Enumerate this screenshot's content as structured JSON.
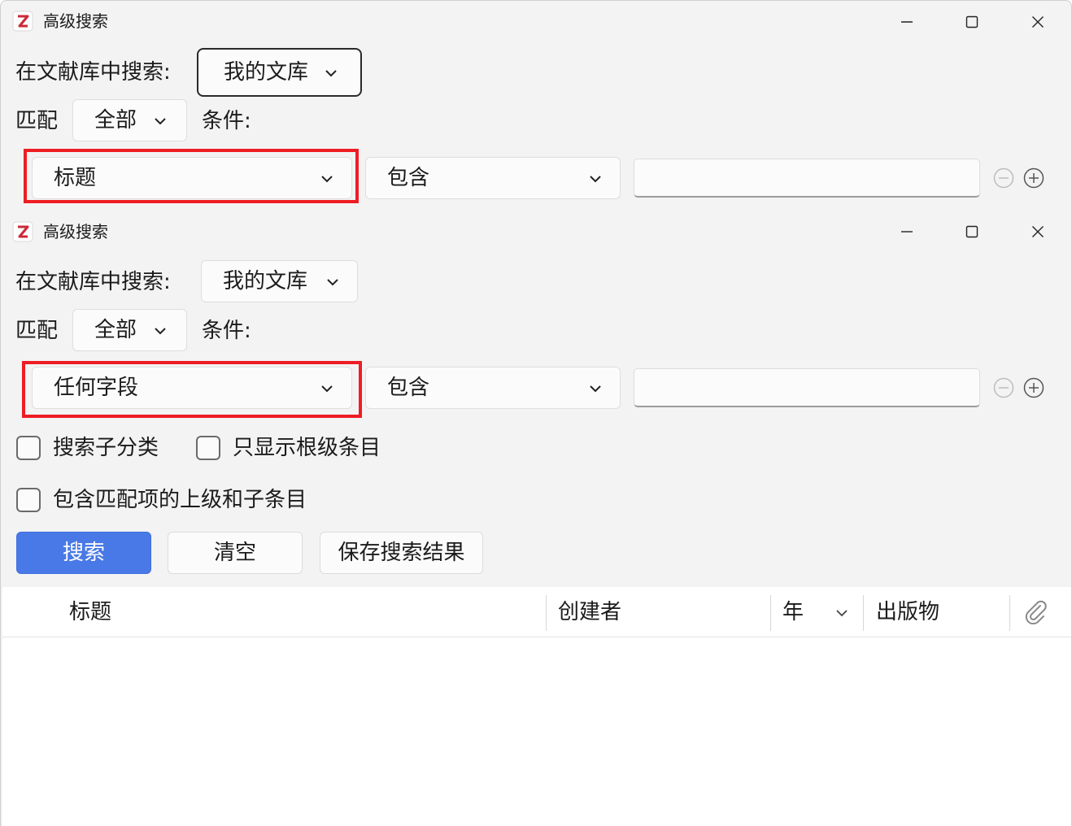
{
  "window_top": {
    "title": "高级搜索",
    "library_label": "在文献库中搜索:",
    "library_value": "我的文库",
    "match_label": "匹配",
    "match_value": "全部",
    "conditions_label": "条件:",
    "field_value": "标题",
    "operator_value": "包含",
    "search_text": ""
  },
  "window_bottom": {
    "title": "高级搜索",
    "library_label": "在文献库中搜索:",
    "library_value": "我的文库",
    "match_label": "匹配",
    "match_value": "全部",
    "conditions_label": "条件:",
    "field_value": "任何字段",
    "operator_value": "包含",
    "search_text": "",
    "checkboxes": [
      {
        "label": "搜索子分类",
        "checked": false
      },
      {
        "label": "只显示根级条目",
        "checked": false
      },
      {
        "label": "包含匹配项的上级和子条目",
        "checked": false
      }
    ],
    "buttons": {
      "search": "搜索",
      "clear": "清空",
      "save": "保存搜索结果"
    },
    "columns": {
      "title": "标题",
      "creator": "创建者",
      "year": "年",
      "publication": "出版物"
    }
  },
  "colors": {
    "highlight": "#ee1d24",
    "primary_button": "#4979e6",
    "app_icon_red": "#cc2936"
  },
  "icons": [
    "zotero-app-icon",
    "minimize-icon",
    "maximize-icon",
    "close-icon",
    "chevron-down-icon",
    "remove-condition-icon",
    "add-condition-icon",
    "attachment-icon"
  ]
}
